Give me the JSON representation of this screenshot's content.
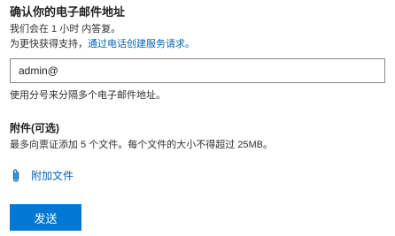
{
  "confirm_email": {
    "title": "确认你的电子邮件地址",
    "response_note": "我们会在 1 小时 内答复。",
    "support_prefix": "为更快获得支持，",
    "support_link": "通过电话创建服务请求。"
  },
  "email_input": {
    "value": "admin@",
    "hint": "使用分号来分隔多个电子邮件地址。"
  },
  "attachments": {
    "title": "附件(可选)",
    "description": "最多向票证添加 5 个文件。每个文件的大小不得超过 25MB。",
    "attach_label": "附加文件",
    "icon": "paperclip-icon"
  },
  "actions": {
    "send_label": "发送"
  },
  "colors": {
    "accent": "#0078d4",
    "link": "#0067b8"
  }
}
